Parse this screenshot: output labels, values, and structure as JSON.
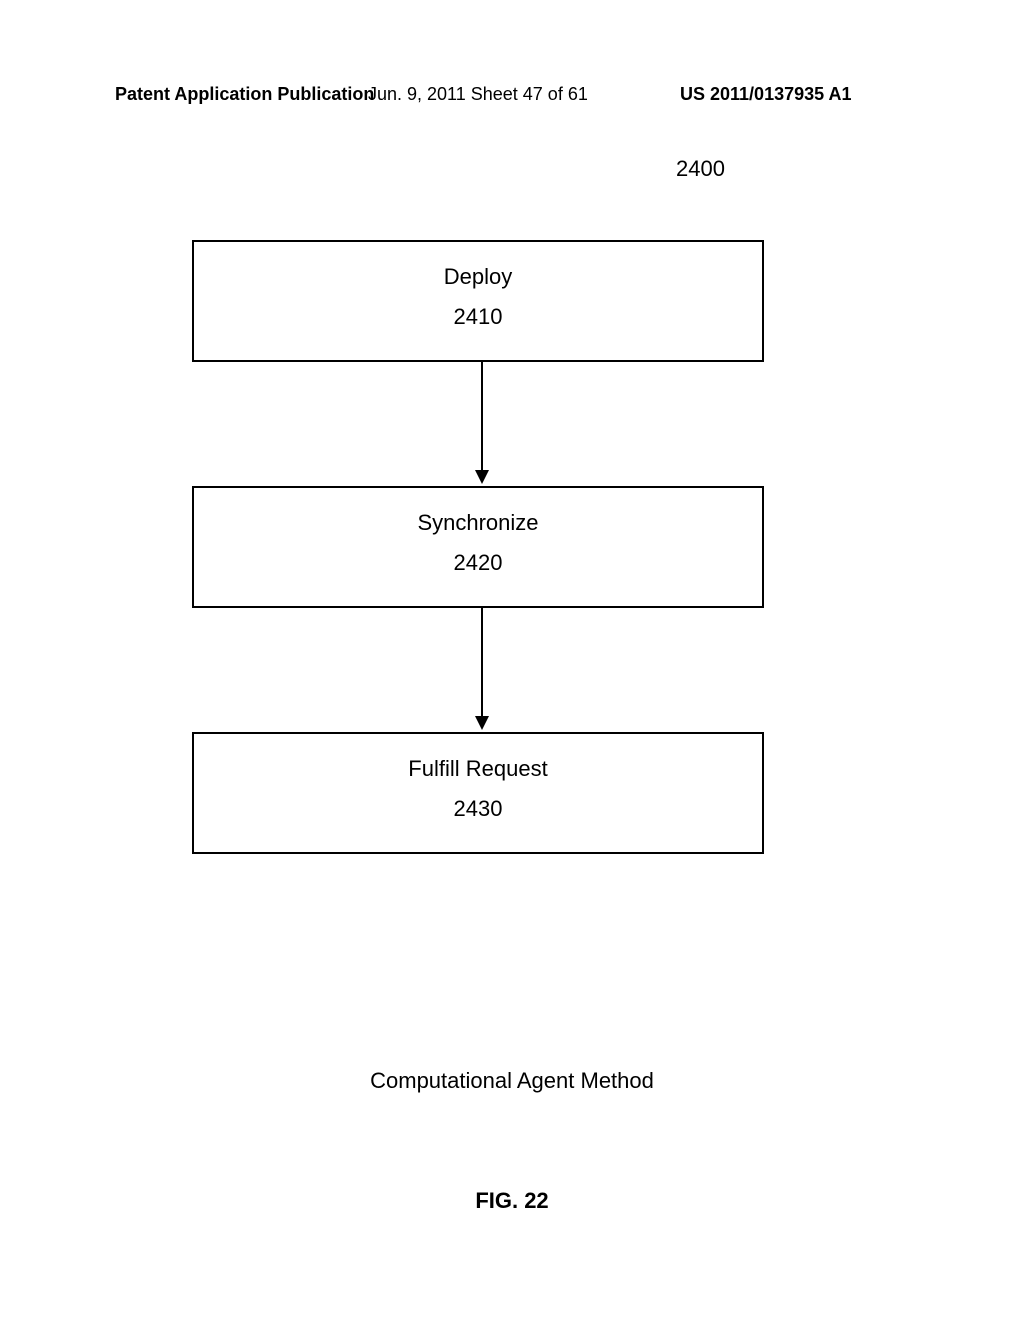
{
  "header": {
    "left": "Patent Application Publication",
    "mid": "Jun. 9, 2011  Sheet 47 of 61",
    "right": "US 2011/0137935 A1"
  },
  "figure_ref": "2400",
  "boxes": [
    {
      "title": "Deploy",
      "num": "2410"
    },
    {
      "title": "Synchronize",
      "num": "2420"
    },
    {
      "title": "Fulfill Request",
      "num": "2430"
    }
  ],
  "caption": "Computational Agent Method",
  "figure_number": "FIG. 22",
  "chart_data": {
    "type": "flowchart",
    "nodes": [
      {
        "id": "2410",
        "label": "Deploy"
      },
      {
        "id": "2420",
        "label": "Synchronize"
      },
      {
        "id": "2430",
        "label": "Fulfill Request"
      }
    ],
    "edges": [
      {
        "from": "2410",
        "to": "2420"
      },
      {
        "from": "2420",
        "to": "2430"
      }
    ],
    "title": "Computational Agent Method",
    "figure": "FIG. 22",
    "overall_ref": "2400"
  }
}
